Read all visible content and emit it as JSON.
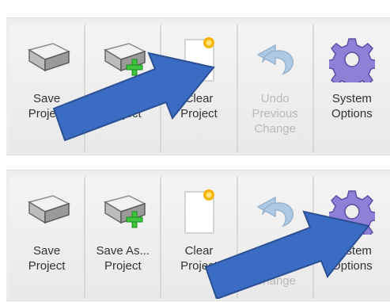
{
  "panels": [
    {
      "buttons": [
        {
          "label": "Save\nProject",
          "icon": "save-drive-icon",
          "enabled": true
        },
        {
          "label": "Save As...\nProject",
          "icon": "save-as-drive-icon",
          "enabled": true
        },
        {
          "label": "Clear\nProject",
          "icon": "new-document-icon",
          "enabled": true
        },
        {
          "label": "Undo\nPrevious\nChange",
          "icon": "undo-icon",
          "enabled": false
        },
        {
          "label": "System\nOptions",
          "icon": "gear-icon",
          "enabled": true
        }
      ],
      "highlighted": "Clear Project"
    },
    {
      "buttons": [
        {
          "label": "Save\nProject",
          "icon": "save-drive-icon",
          "enabled": true
        },
        {
          "label": "Save As...\nProject",
          "icon": "save-as-drive-icon",
          "enabled": true
        },
        {
          "label": "Clear\nProject",
          "icon": "new-document-icon",
          "enabled": true
        },
        {
          "label": "Undo\nPrevious\nChange",
          "icon": "undo-icon",
          "enabled": false
        },
        {
          "label": "System\nOptions",
          "icon": "gear-icon",
          "enabled": true
        }
      ],
      "highlighted": "System Options"
    }
  ],
  "colors": {
    "arrow": "#3b6cc4",
    "arrow_border": "#2c4f93",
    "panel_bg": "#eeeeee",
    "gear": "#8f7fd6",
    "undo": "#5b9bd5",
    "star": "#f5b400",
    "plus": "#3cc43c"
  }
}
